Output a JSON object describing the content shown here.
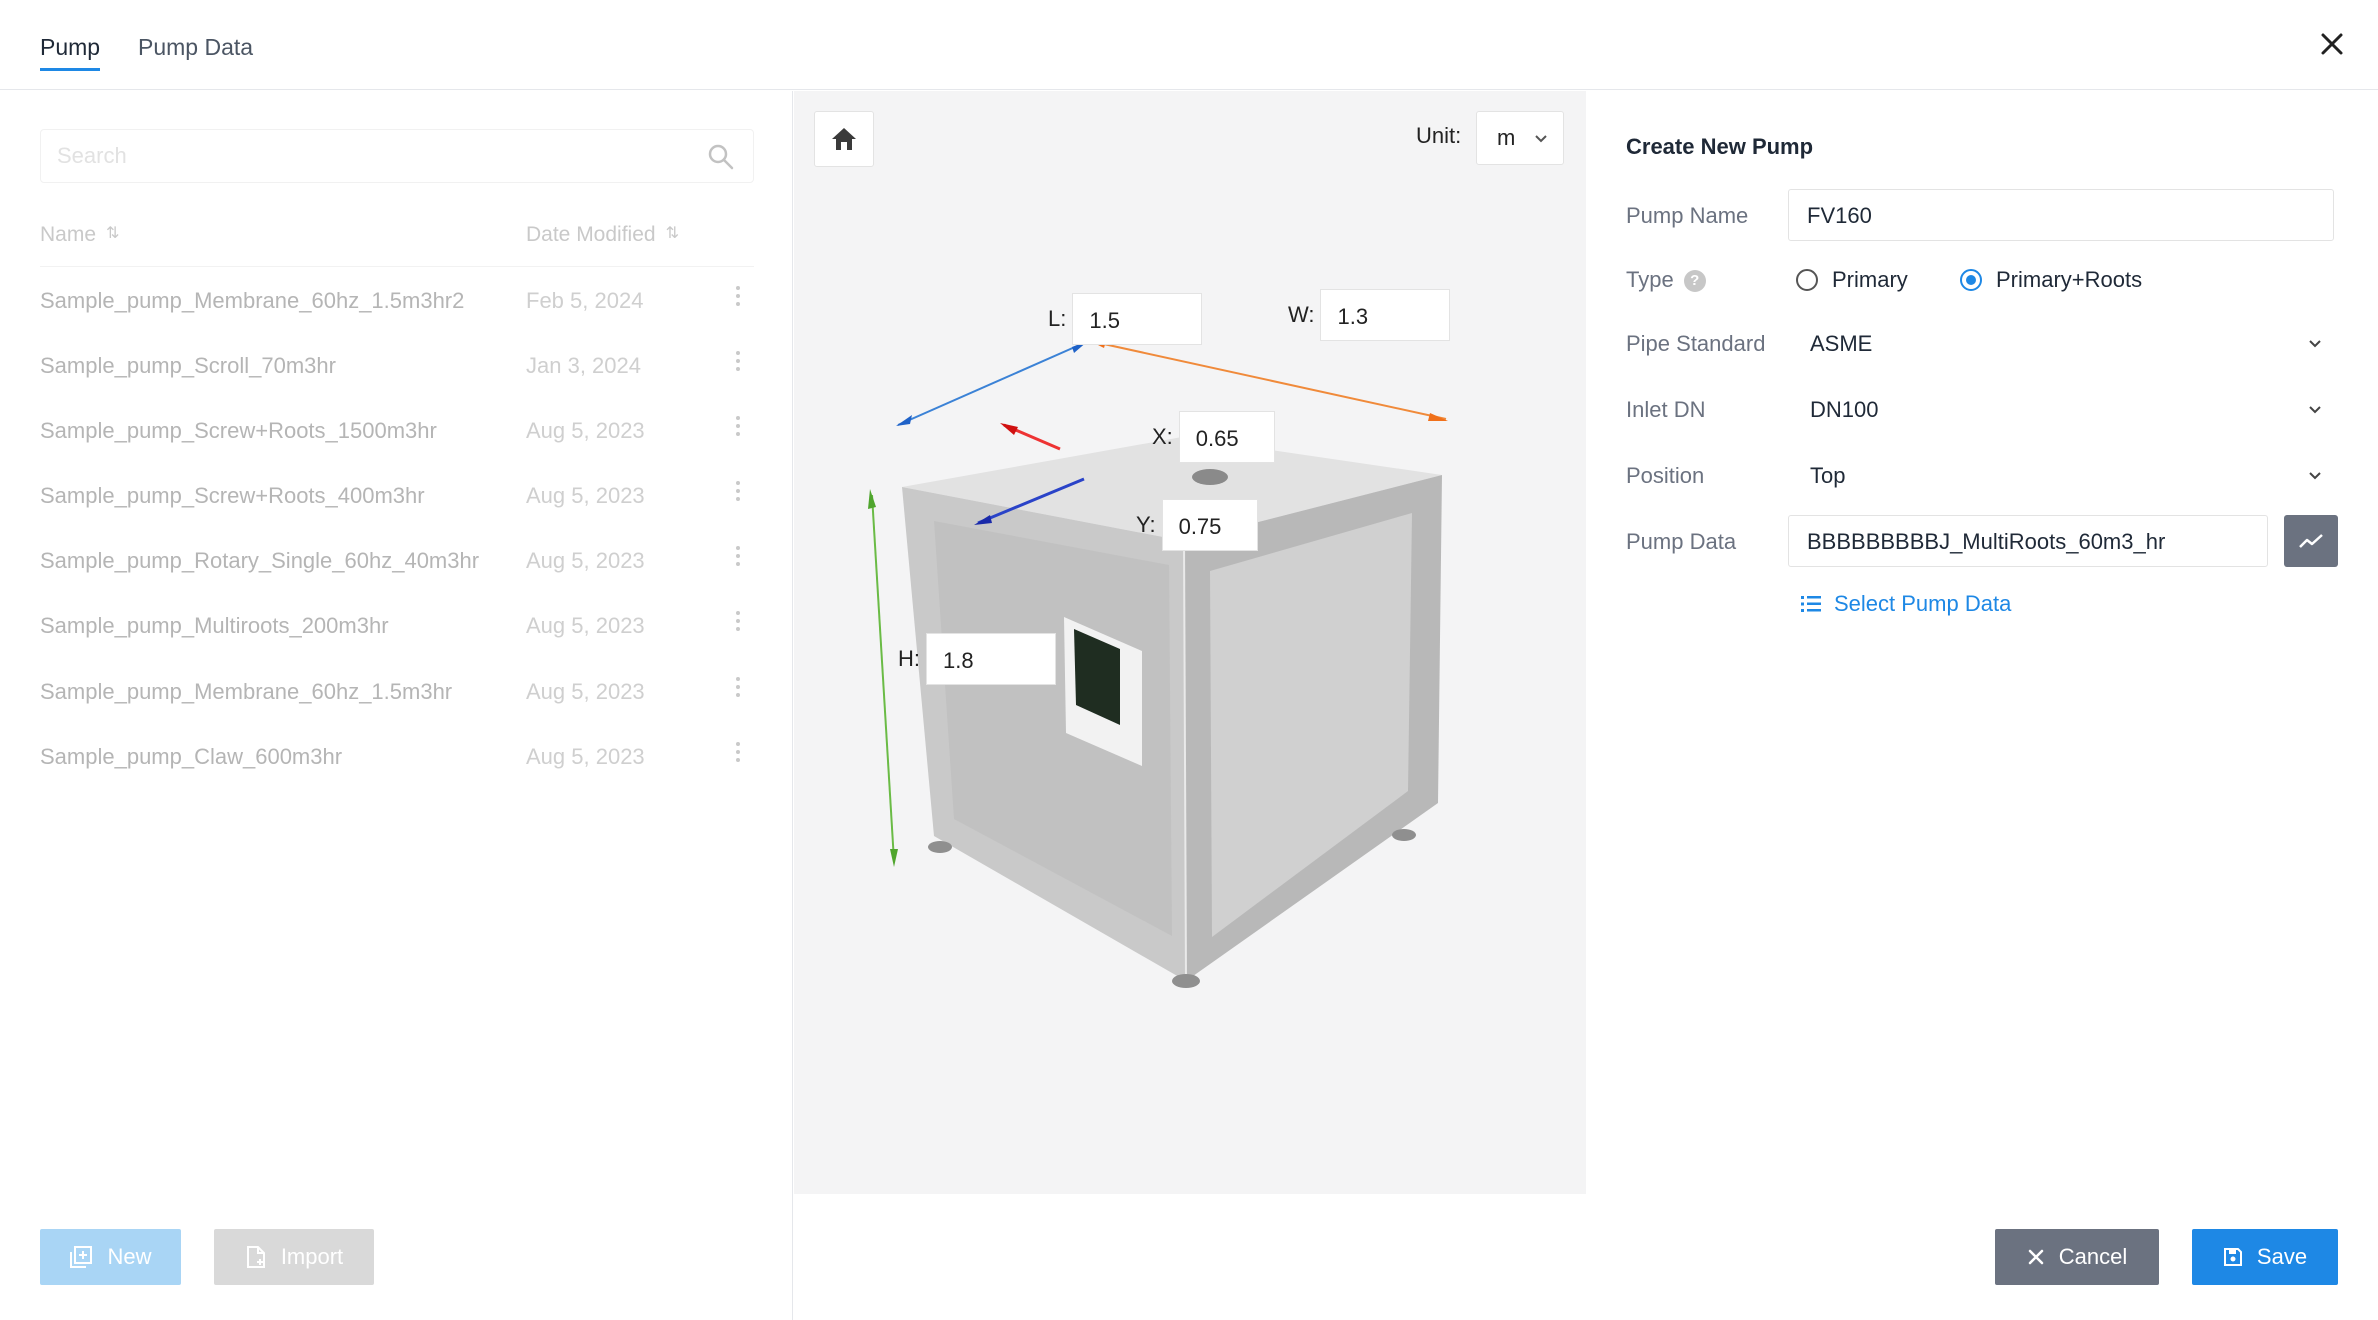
{
  "tabs": [
    {
      "label": "Pump",
      "active": true
    },
    {
      "label": "Pump Data",
      "active": false
    }
  ],
  "list": {
    "search_placeholder": "Search",
    "columns": {
      "name": "Name",
      "date": "Date Modified"
    },
    "rows": [
      {
        "name": "Sample_pump_Membrane_60hz_1.5m3hr2",
        "date": "Feb 5, 2024"
      },
      {
        "name": "Sample_pump_Scroll_70m3hr",
        "date": "Jan 3, 2024"
      },
      {
        "name": "Sample_pump_Screw+Roots_1500m3hr",
        "date": "Aug 5, 2023"
      },
      {
        "name": "Sample_pump_Screw+Roots_400m3hr",
        "date": "Aug 5, 2023"
      },
      {
        "name": "Sample_pump_Rotary_Single_60hz_40m3hr",
        "date": "Aug 5, 2023"
      },
      {
        "name": "Sample_pump_Multiroots_200m3hr",
        "date": "Aug 5, 2023"
      },
      {
        "name": "Sample_pump_Membrane_60hz_1.5m3hr",
        "date": "Aug 5, 2023"
      },
      {
        "name": "Sample_pump_Claw_600m3hr",
        "date": "Aug 5, 2023"
      }
    ],
    "new_label": "New",
    "import_label": "Import"
  },
  "viewer": {
    "unit_label": "Unit:",
    "unit_value": "m",
    "dims": {
      "L": {
        "label": "L:",
        "value": "1.5"
      },
      "W": {
        "label": "W:",
        "value": "1.3"
      },
      "X": {
        "label": "X:",
        "value": "0.65"
      },
      "Y": {
        "label": "Y:",
        "value": "0.75"
      },
      "H": {
        "label": "H:",
        "value": "1.8"
      }
    }
  },
  "form": {
    "title": "Create New Pump",
    "pump_name_label": "Pump Name",
    "pump_name_value": "FV160",
    "type_label": "Type",
    "type_options": [
      "Primary",
      "Primary+Roots"
    ],
    "type_selected": "Primary+Roots",
    "pipe_standard_label": "Pipe Standard",
    "pipe_standard_value": "ASME",
    "inlet_dn_label": "Inlet DN",
    "inlet_dn_value": "DN100",
    "position_label": "Position",
    "position_value": "Top",
    "pump_data_label": "Pump Data",
    "pump_data_value": "BBBBBBBBBJ_MultiRoots_60m3_hr",
    "select_pump_data_label": "Select Pump Data",
    "cancel_label": "Cancel",
    "save_label": "Save"
  },
  "colors": {
    "accent": "#1e88e5",
    "cancel": "#6b7280",
    "new_disabled": "#a9d5f5",
    "import_disabled": "#d9d9d9"
  }
}
